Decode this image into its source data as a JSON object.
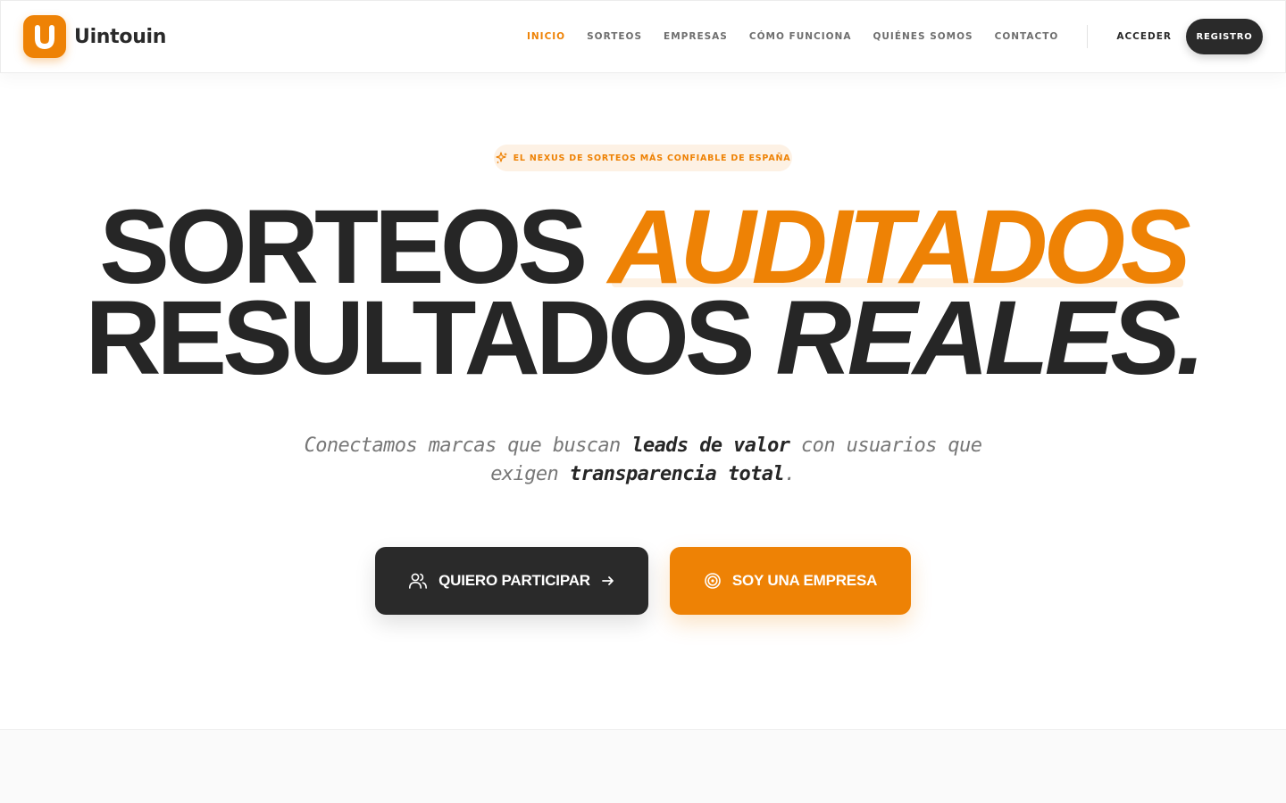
{
  "brand": {
    "name": "Uintouin",
    "logo_letter": "U"
  },
  "nav": {
    "items": [
      {
        "label": "INICIO",
        "active": true
      },
      {
        "label": "SORTEOS",
        "active": false
      },
      {
        "label": "EMPRESAS",
        "active": false
      },
      {
        "label": "CÓMO FUNCIONA",
        "active": false
      },
      {
        "label": "QUIÉNES SOMOS",
        "active": false
      },
      {
        "label": "CONTACTO",
        "active": false
      }
    ],
    "login_label": "ACCEDER",
    "register_label": "REGISTRO"
  },
  "hero": {
    "badge": {
      "icon": "sparkles-icon",
      "text": "EL NEXUS DE SORTEOS MÁS CONFIABLE DE ESPAÑA"
    },
    "headline": {
      "line1_plain": "SORTEOS",
      "line1_accent": "AUDITADOS",
      "line2_plain": "RESULTADOS",
      "line2_italic": "REALES."
    },
    "subtitle": {
      "part1": "Conectamos marcas que buscan ",
      "bold1": "leads de valor",
      "part2": " con usuarios que exigen ",
      "bold2": "transparencia total",
      "part3": "."
    },
    "cta_primary": {
      "label": "QUIERO PARTICIPAR",
      "icon": "users-icon",
      "trailing_icon": "arrow-right-icon"
    },
    "cta_secondary": {
      "label": "SOY UNA EMPRESA",
      "icon": "target-icon"
    }
  },
  "colors": {
    "accent": "#ee8205",
    "dark": "#2a2a2a",
    "badge_bg": "#fdf1e4"
  }
}
